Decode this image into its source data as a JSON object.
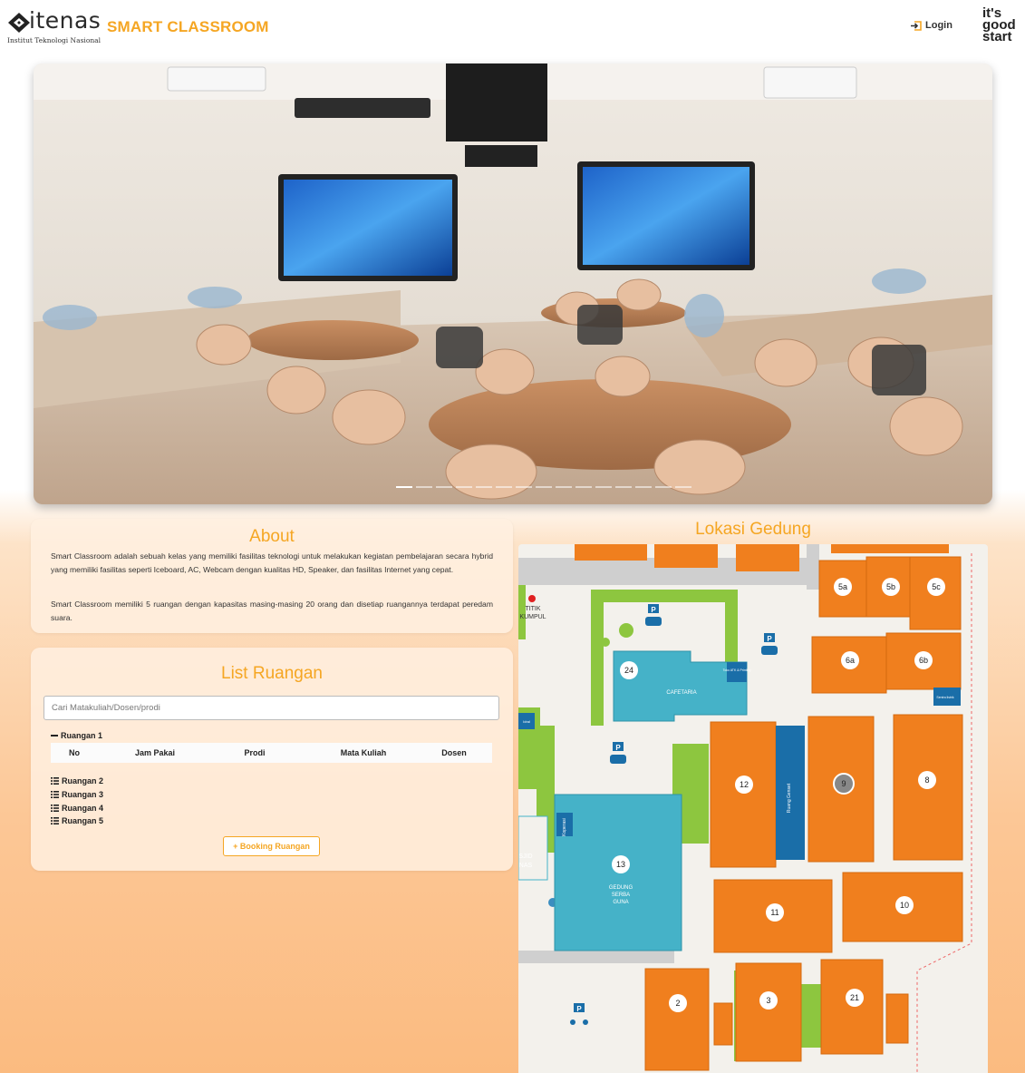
{
  "header": {
    "logo_word": "itenas",
    "logo_sub": "Institut Teknologi Nasional",
    "brand_title": "SMART CLASSROOM",
    "login_label": "Login",
    "tagline_lines": [
      "it's",
      "good",
      "start"
    ]
  },
  "carousel": {
    "slide_count": 15,
    "active_index": 0
  },
  "about": {
    "title": "About",
    "paragraph1": "Smart Classroom adalah sebuah kelas yang memiliki fasilitas teknologi untuk melakukan kegiatan pembelajaran secara hybrid yang memiliki fasilitas seperti Iceboard, AC, Webcam dengan kualitas HD, Speaker, dan fasilitas Internet yang cepat.",
    "paragraph2": "Smart Classroom memiliki 5 ruangan dengan kapasitas masing-masing 20 orang dan disetiap ruangannya terdapat peredam suara."
  },
  "list": {
    "title": "List Ruangan",
    "search_placeholder": "Cari Matakuliah/Dosen/prodi",
    "open_room": "Ruangan 1",
    "columns": [
      "No",
      "Jam Pakai",
      "Prodi",
      "Mata Kuliah",
      "Dosen"
    ],
    "collapsed_rooms": [
      "Ruangan 2",
      "Ruangan 3",
      "Ruangan 4",
      "Ruangan 5"
    ],
    "booking_label": "+ Booking Ruangan"
  },
  "map": {
    "title": "Lokasi Gedung",
    "buildings": [
      "5a",
      "5b",
      "5c",
      "6a",
      "6b",
      "24",
      "12",
      "9",
      "8",
      "13",
      "11",
      "10",
      "2",
      "3",
      "21"
    ],
    "labels": {
      "cafetaria": "CAFETARIA",
      "gedung_line1": "GEDUNG",
      "gedung_line2": "SERBA",
      "gedung_line3": "GUNA",
      "titik_line1": "TITIK",
      "titik_line2": "KUMPUL",
      "masjid_line1": "SJID",
      "masjid_line2": "NAS",
      "parking": "P",
      "koperasi": "Koperasi",
      "ruang_genset": "Ruang Genset",
      "toko": "Toko ATK & Printing",
      "sentra": "Sentra listrik",
      "kiri": "Idral"
    }
  },
  "colors": {
    "accent": "#f5a623",
    "building_orange": "#f07f1e",
    "building_teal": "#45b2c8",
    "building_blue": "#1a6ea8",
    "green": "#8dc63f"
  }
}
